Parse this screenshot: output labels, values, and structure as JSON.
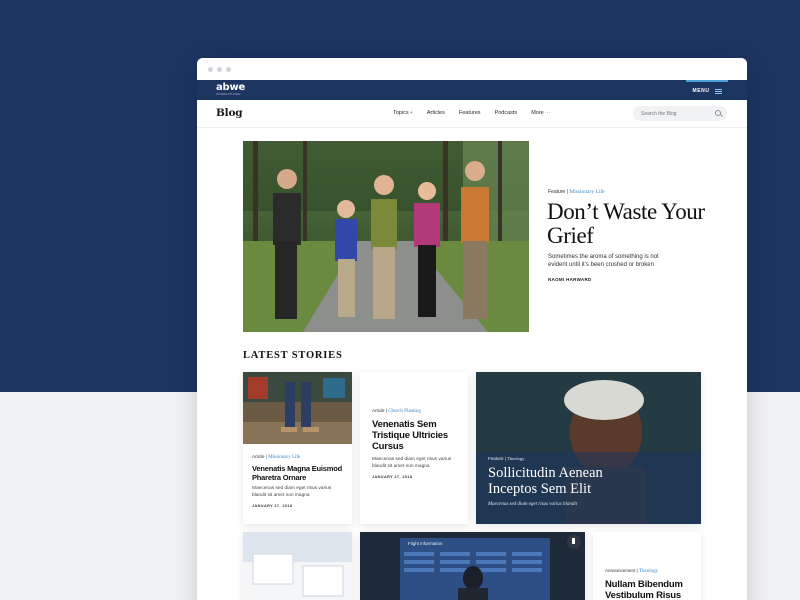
{
  "site": {
    "logo_text": "abwe",
    "logo_sub": "INTERNATIONAL",
    "menu_label": "MENU"
  },
  "blog_nav": {
    "title": "Blog",
    "links": [
      {
        "label": "Topics",
        "accent": "+"
      },
      {
        "label": "Articles",
        "accent": ""
      },
      {
        "label": "Features",
        "accent": ""
      },
      {
        "label": "Podcasts",
        "accent": ""
      },
      {
        "label": "More",
        "accent": "···"
      }
    ],
    "search_placeholder": "Search the Blog"
  },
  "hero": {
    "type": "Feature",
    "separator": "|",
    "category": "Missionary Life",
    "title": "Don’t Waste Your Grief",
    "subtitle": "Sometimes the aroma of something is not evident until it’s been crushed or broken",
    "author": "NAOMI HARWARD"
  },
  "latest": {
    "heading": "LATEST STORIES",
    "cards": [
      {
        "type": "Article",
        "category": "Missionary Life",
        "title": "Venenatis Magna Euismod Pharetra Ornare",
        "desc": "Maecenas sed diam eget risus varius blandit sit amet non magna",
        "date": "JANUARY 27, 2018"
      },
      {
        "type": "Article",
        "category": "Church Planting",
        "title": "Venenatis Sem Tristique Ultricies Cursus",
        "desc": "Maecenas sed diam eget risus varius blandit sit amet non magna",
        "date": "JANUARY 27, 2018"
      },
      {
        "type": "Feature",
        "category": "Theology",
        "title": "Sollicitudin Aenean Inceptos Sem Elit",
        "desc": "Maecenas sed diam eget risus varius blandit"
      },
      {
        "type": "Announcement",
        "category": "Theology",
        "title": "Nullam Bibendum Vestibulum Risus"
      }
    ],
    "flight_sign": "Flight information"
  },
  "colors": {
    "navy": "#1d3561",
    "accent": "#3b86c6"
  }
}
